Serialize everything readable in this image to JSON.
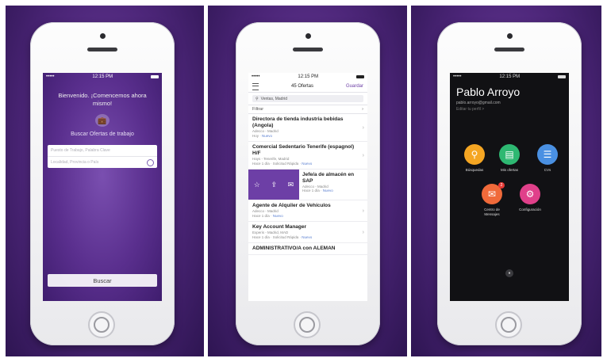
{
  "status_time": "12:15 PM",
  "screen1": {
    "welcome": "Bienvenido. ¡Comencemos ahora mismo!",
    "subtitle": "Buscar Ofertas de trabajo",
    "keyword_placeholder": "Puesto de Trabajo, Palabra Clave",
    "location_placeholder": "Localidad, Provincia o País",
    "search_button": "Buscar"
  },
  "screen2": {
    "title": "45 Ofertas",
    "save": "Guardar",
    "search_value": "Ventas, Madrid",
    "filter": "Filtrar",
    "jobs": [
      {
        "title": "Directora de tienda industria bebidas (Angola)",
        "meta": "Adecco - Madrid",
        "date": "Hoy",
        "tag": "Nuevo"
      },
      {
        "title": "Comercial Sedentario Tenerife (espagnol) H/F",
        "meta": "Hays - Tenerife, Madrid",
        "date": "Hace 1 día · Solicitud Rápida",
        "tag": "Nuevo"
      },
      {
        "title": "Agente de Alquiler de Vehículos",
        "meta": "Adecco - Madrid",
        "date": "Hace 1 día",
        "tag": "Nuevo"
      },
      {
        "title": "Key Account Manager",
        "meta": "Experis - Madrid, MAD",
        "date": "Hace 1 día · Solicitud Rápida",
        "tag": "Nuevo"
      },
      {
        "title": "ADMINISTRATIVO/A con ALEMAN",
        "meta": "",
        "date": "",
        "tag": ""
      }
    ],
    "swipe_job": {
      "title": "Jefe/a de almacén en SAP",
      "meta": "Adecco - Madrid",
      "date": "Hace 1 día",
      "tag": "Nuevo"
    }
  },
  "screen3": {
    "name": "Pablo Arroyo",
    "email": "pablo.arroyo@gmail.com",
    "profile_link": "Editar tu perfil >",
    "menu": [
      {
        "label": "Búsquedas",
        "icon": "search-icon",
        "color": "#f5a623"
      },
      {
        "label": "Mis ofertas",
        "icon": "briefcase-icon",
        "color": "#2eb872"
      },
      {
        "label": "CVs",
        "icon": "document-icon",
        "color": "#4a90e2"
      },
      {
        "label": "Centro de Mensajes",
        "icon": "envelope-icon",
        "color": "#f06a3a",
        "badge": "2"
      },
      {
        "label": "Configuración",
        "icon": "gear-icon",
        "color": "#e0408a"
      }
    ]
  }
}
